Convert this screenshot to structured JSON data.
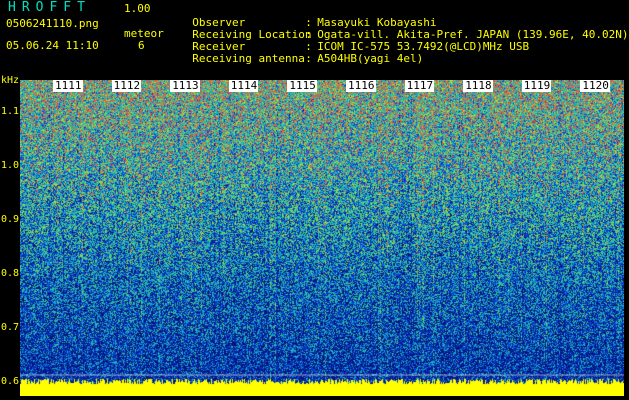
{
  "app": {
    "name": "HROFFT",
    "version": "1.00"
  },
  "file": {
    "name": "0506241110.png",
    "datetime": "05.06.24 11:10"
  },
  "event": {
    "label": "meteor",
    "count": "6"
  },
  "info": [
    {
      "key": "Observer",
      "value": "Masayuki Kobayashi"
    },
    {
      "key": "Receiving Location",
      "value": "Ogata-vill. Akita-Pref. JAPAN (139.96E, 40.02N)"
    },
    {
      "key": "Receiver",
      "value": "ICOM IC-575 53.7492(@LCD)MHz USB"
    },
    {
      "key": "Receiving antenna",
      "value": "A504HB(yagi 4el)"
    }
  ],
  "axis": {
    "unit": "kHz",
    "y_ticks": [
      "1.1",
      "1.0",
      "0.9",
      "0.8",
      "0.7",
      "0.6"
    ],
    "y_values": [
      1.1,
      1.0,
      0.9,
      0.8,
      0.7,
      0.6
    ],
    "ylim": [
      0.575,
      1.16
    ],
    "minutes": [
      "1111",
      "1112",
      "1113",
      "1114",
      "1115",
      "1116",
      "1117",
      "1118",
      "1119",
      "1120"
    ]
  },
  "colors": {
    "text": "#ffff00",
    "title": "#00e0c0",
    "background": "#000000"
  }
}
